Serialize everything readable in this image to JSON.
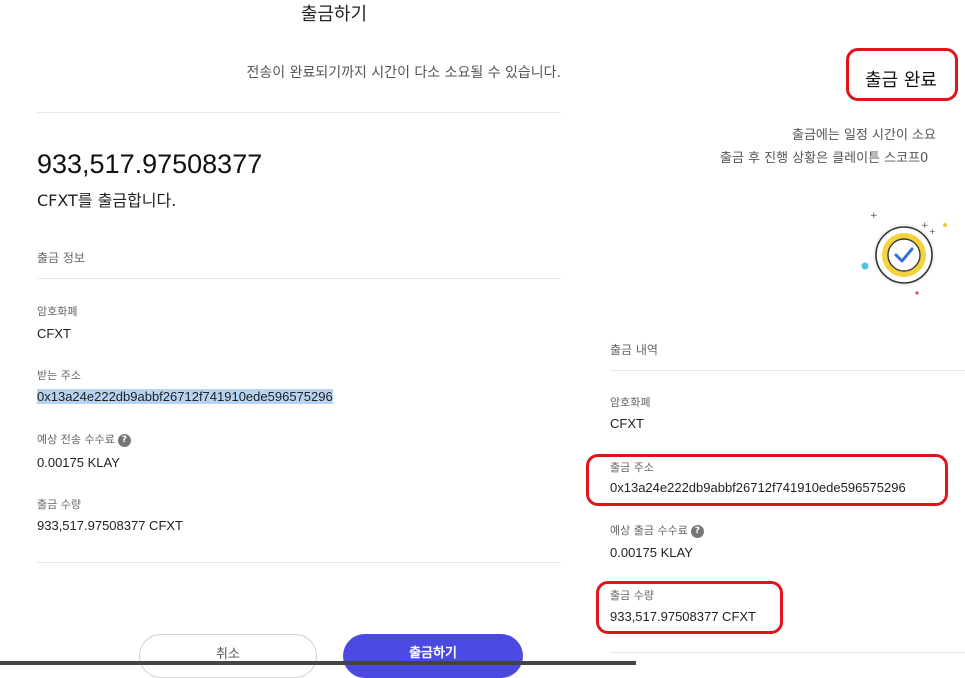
{
  "left": {
    "title": "출금하기",
    "notice": "전송이 완료되기까지 시간이 다소 소요될 수 있습니다.",
    "amount": "933,517.97508377",
    "amount_desc": "CFXT를 출금합니다.",
    "section_title": "출금 정보",
    "fields": {
      "currency_label": "암호화폐",
      "currency_value": "CFXT",
      "address_label": "받는 주소",
      "address_value": "0x13a24e222db9abbf26712f741910ede596575296",
      "fee_label": "예상 전송 수수료",
      "fee_value": "0.00175 KLAY",
      "quantity_label": "출금 수량",
      "quantity_value": "933,517.97508377 CFXT"
    },
    "help_glyph": "?",
    "cancel_label": "취소",
    "submit_label": "출금하기"
  },
  "right": {
    "title": "출금 완료",
    "notice_line1": "출금에는 일정 시간이 소요",
    "notice_line2": "출금 후 진행 상황은 클레이튼 스코프0",
    "section_title": "출금 내역",
    "fields": {
      "currency_label": "암호화폐",
      "currency_value": "CFXT",
      "address_label": "출금 주소",
      "address_value": "0x13a24e222db9abbf26712f741910ede596575296",
      "fee_label": "예상 출금 수수료",
      "fee_value": "0.00175 KLAY",
      "quantity_label": "출금 수량",
      "quantity_value": "933,517.97508377 CFXT"
    },
    "help_glyph": "?"
  },
  "colors": {
    "primary_button": "#4a49e2",
    "highlight_box": "#e0141b",
    "selection": "#b7d3f2",
    "check_yellow": "#f5d33a"
  },
  "icons": [
    "check-circle-icon",
    "help-icon"
  ]
}
